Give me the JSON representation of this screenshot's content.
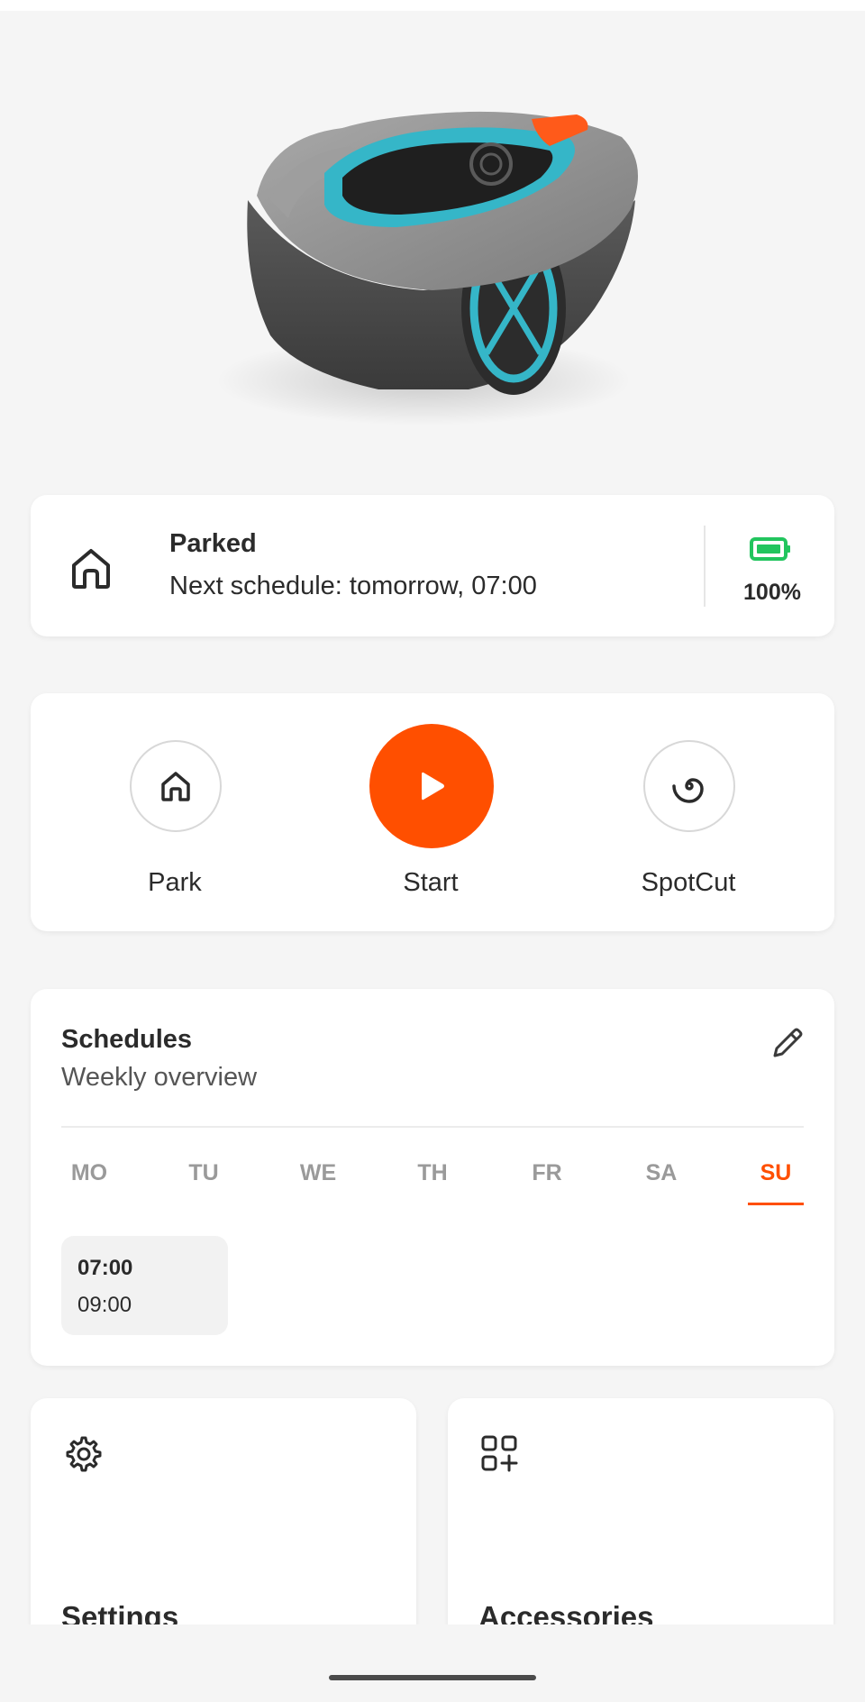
{
  "status": {
    "icon": "home-icon",
    "title": "Parked",
    "subtitle": "Next schedule: tomorrow, 07:00",
    "battery_icon": "battery-icon",
    "battery": "100%",
    "battery_color": "#22c55e"
  },
  "actions": [
    {
      "label": "Park",
      "icon": "home-icon"
    },
    {
      "label": "Start",
      "icon": "play-icon",
      "color": "#ff4f00"
    },
    {
      "label": "SpotCut",
      "icon": "spiral-icon"
    }
  ],
  "schedules": {
    "title": "Schedules",
    "subtitle": "Weekly overview",
    "edit_icon": "pencil-icon",
    "days": [
      "MO",
      "TU",
      "WE",
      "TH",
      "FR",
      "SA",
      "SU"
    ],
    "active_day": "SU",
    "slots": [
      {
        "start": "07:00",
        "end": "09:00"
      }
    ]
  },
  "tiles": [
    {
      "label": "Settings",
      "icon": "gear-icon"
    },
    {
      "label": "Accessories",
      "icon": "grid-plus-icon"
    }
  ],
  "colors": {
    "accent": "#ff4f00",
    "teal": "#35b6c8",
    "background": "#f5f5f5"
  }
}
